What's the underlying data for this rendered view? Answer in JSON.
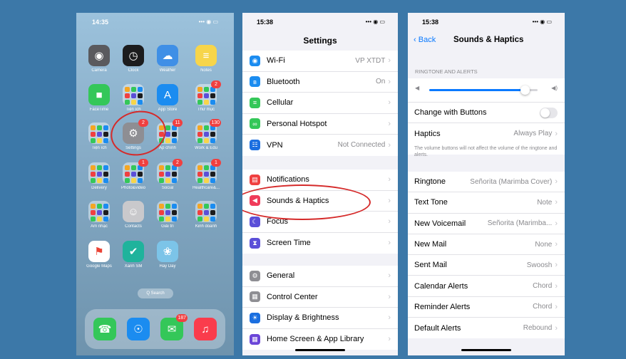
{
  "home": {
    "time": "14:35",
    "status_icons": "••• ◉ ▭",
    "apps": [
      {
        "label": "Camera",
        "color": "#5a5a5e",
        "glyph": "◉"
      },
      {
        "label": "Clock",
        "color": "#1c1c1e",
        "glyph": "◷"
      },
      {
        "label": "Weather",
        "color": "#3f8fe6",
        "glyph": "☁"
      },
      {
        "label": "Notes",
        "color": "#f7d54a",
        "glyph": "≡"
      },
      {
        "label": "FaceTime",
        "color": "#34c759",
        "glyph": "■"
      },
      {
        "label": "Tiện ích",
        "color": "#d9d9d9",
        "glyph": "",
        "folder": true
      },
      {
        "label": "App Store",
        "color": "#1b8cf0",
        "glyph": "A"
      },
      {
        "label": "Thư mục",
        "color": "#d9d9d9",
        "glyph": "",
        "folder": true,
        "badge": "2"
      },
      {
        "label": "Tiện ích",
        "color": "#d9d9d9",
        "glyph": "",
        "folder": true
      },
      {
        "label": "Settings",
        "color": "#8e8e93",
        "glyph": "⚙",
        "badge": "2"
      },
      {
        "label": "Áp chính",
        "color": "#d9d9d9",
        "glyph": "",
        "folder": true,
        "badge": "11"
      },
      {
        "label": "Work & Edu",
        "color": "#d9d9d9",
        "glyph": "",
        "folder": true,
        "badge": "130"
      },
      {
        "label": "Delivery",
        "color": "#d9d9d9",
        "glyph": "",
        "folder": true
      },
      {
        "label": "Photo&video",
        "color": "#d9d9d9",
        "glyph": "",
        "folder": true,
        "badge": "1"
      },
      {
        "label": "Social",
        "color": "#d9d9d9",
        "glyph": "",
        "folder": true,
        "badge": "2"
      },
      {
        "label": "Healthcare&...",
        "color": "#d9d9d9",
        "glyph": "",
        "folder": true,
        "badge": "1"
      },
      {
        "label": "Âm nhạc",
        "color": "#d9d9d9",
        "glyph": "",
        "folder": true
      },
      {
        "label": "Contacts",
        "color": "#c9c9cc",
        "glyph": "☺"
      },
      {
        "label": "Giải trí",
        "color": "#d9d9d9",
        "glyph": "",
        "folder": true
      },
      {
        "label": "Kinh doanh",
        "color": "#d9d9d9",
        "glyph": "",
        "folder": true
      },
      {
        "label": "Google Maps",
        "color": "#ffffff",
        "glyph": "⚑"
      },
      {
        "label": "Xanh SM",
        "color": "#1fb39c",
        "glyph": "✔"
      },
      {
        "label": "Hay Day",
        "color": "#7cc4e8",
        "glyph": "❀"
      }
    ],
    "search": "Q Search",
    "dock": [
      {
        "label": "Phone",
        "color": "#34c759",
        "glyph": "☎"
      },
      {
        "label": "Safari",
        "color": "#1b8cf0",
        "glyph": "☉"
      },
      {
        "label": "Messages",
        "color": "#34c759",
        "glyph": "✉",
        "badge": "187"
      },
      {
        "label": "Music",
        "color": "#fa3c4c",
        "glyph": "♫"
      }
    ]
  },
  "settings": {
    "time": "15:38",
    "status_icons": "••• ◉ ▭",
    "title": "Settings",
    "groups": [
      [
        {
          "label": "Wi-Fi",
          "value": "VP XTDT",
          "color": "#1b8cf0",
          "glyph": "◉"
        },
        {
          "label": "Bluetooth",
          "value": "On",
          "color": "#1b8cf0",
          "glyph": "ʙ"
        },
        {
          "label": "Cellular",
          "value": "",
          "color": "#34c759",
          "glyph": "≡"
        },
        {
          "label": "Personal Hotspot",
          "value": "",
          "color": "#34c759",
          "glyph": "∞"
        },
        {
          "label": "VPN",
          "value": "Not Connected",
          "color": "#1b6fe0",
          "glyph": "☷"
        }
      ],
      [
        {
          "label": "Notifications",
          "value": "",
          "color": "#f04040",
          "glyph": "▤"
        },
        {
          "label": "Sounds & Haptics",
          "value": "",
          "color": "#f03c5a",
          "glyph": "◀"
        },
        {
          "label": "Focus",
          "value": "",
          "color": "#5b4fd8",
          "glyph": "☾"
        },
        {
          "label": "Screen Time",
          "value": "",
          "color": "#5b4fd8",
          "glyph": "⧗"
        }
      ],
      [
        {
          "label": "General",
          "value": "",
          "color": "#8e8e93",
          "glyph": "⚙"
        },
        {
          "label": "Control Center",
          "value": "",
          "color": "#8e8e93",
          "glyph": "▦"
        },
        {
          "label": "Display & Brightness",
          "value": "",
          "color": "#1b6fe0",
          "glyph": "☀"
        },
        {
          "label": "Home Screen & App Library",
          "value": "",
          "color": "#6b46d8",
          "glyph": "▦"
        }
      ]
    ]
  },
  "sounds": {
    "time": "15:38",
    "status_icons": "••• ◉ ▭",
    "back_label": "Back",
    "title": "Sounds & Haptics",
    "section": "RINGTONE AND ALERTS",
    "volume": 0.88,
    "change_with_buttons": "Change with Buttons",
    "haptics_label": "Haptics",
    "haptics_value": "Always Play",
    "footnote": "The volume buttons will not affect the volume of the ringtone and alerts.",
    "rows": [
      {
        "label": "Ringtone",
        "value": "Señorita (Marimba Cover)"
      },
      {
        "label": "Text Tone",
        "value": "Note"
      },
      {
        "label": "New Voicemail",
        "value": "Señorita (Marimba..."
      },
      {
        "label": "New Mail",
        "value": "None"
      },
      {
        "label": "Sent Mail",
        "value": "Swoosh"
      },
      {
        "label": "Calendar Alerts",
        "value": "Chord"
      },
      {
        "label": "Reminder Alerts",
        "value": "Chord"
      },
      {
        "label": "Default Alerts",
        "value": "Rebound"
      }
    ]
  }
}
